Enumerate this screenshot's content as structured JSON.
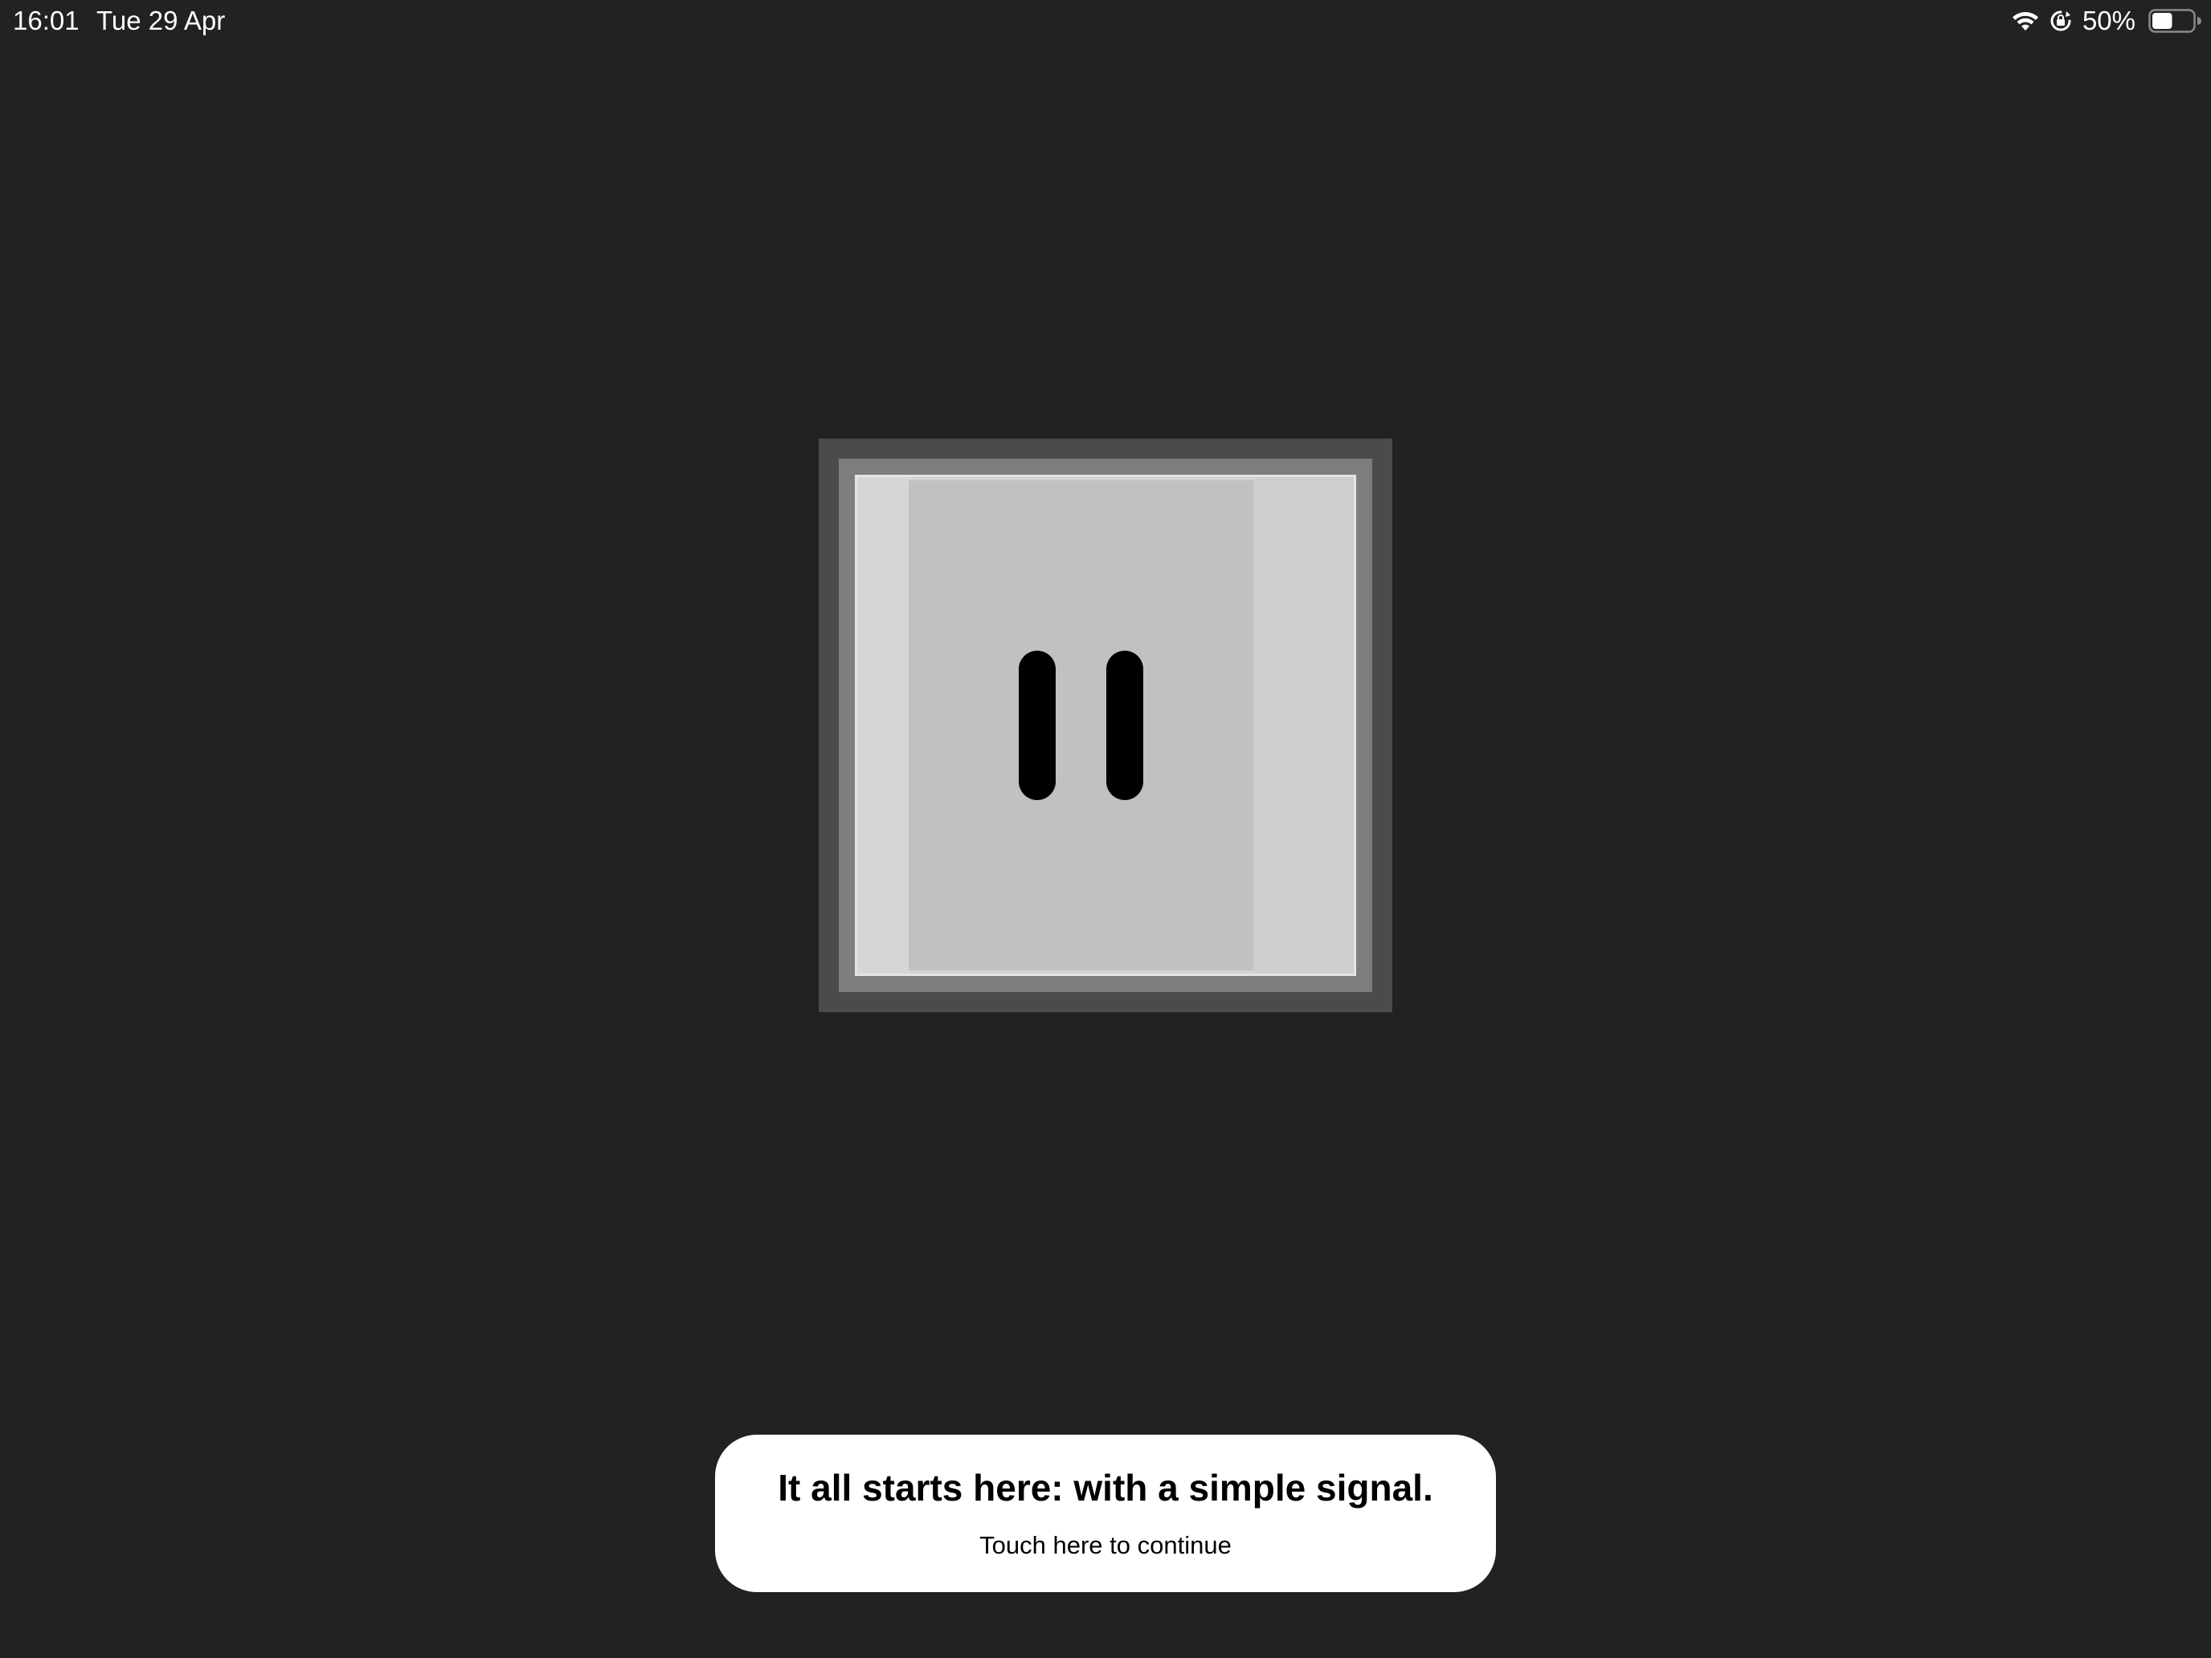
{
  "status_bar": {
    "time": "16:01",
    "date": "Tue 29 Apr",
    "battery_percent": "50%",
    "battery_level": 0.5,
    "icons": [
      "wifi-icon",
      "orientation-lock-icon",
      "battery-icon"
    ]
  },
  "device": {
    "state_icon": "pause-icon"
  },
  "message": {
    "title": "It all starts here: with a simple signal.",
    "subtitle": "Touch here to continue"
  },
  "colors": {
    "background": "#222222",
    "card": "#ffffff",
    "device_outer": "#4b4b4b",
    "device_mid": "#7e7e7e",
    "device_screen": "#c1c1c2"
  }
}
